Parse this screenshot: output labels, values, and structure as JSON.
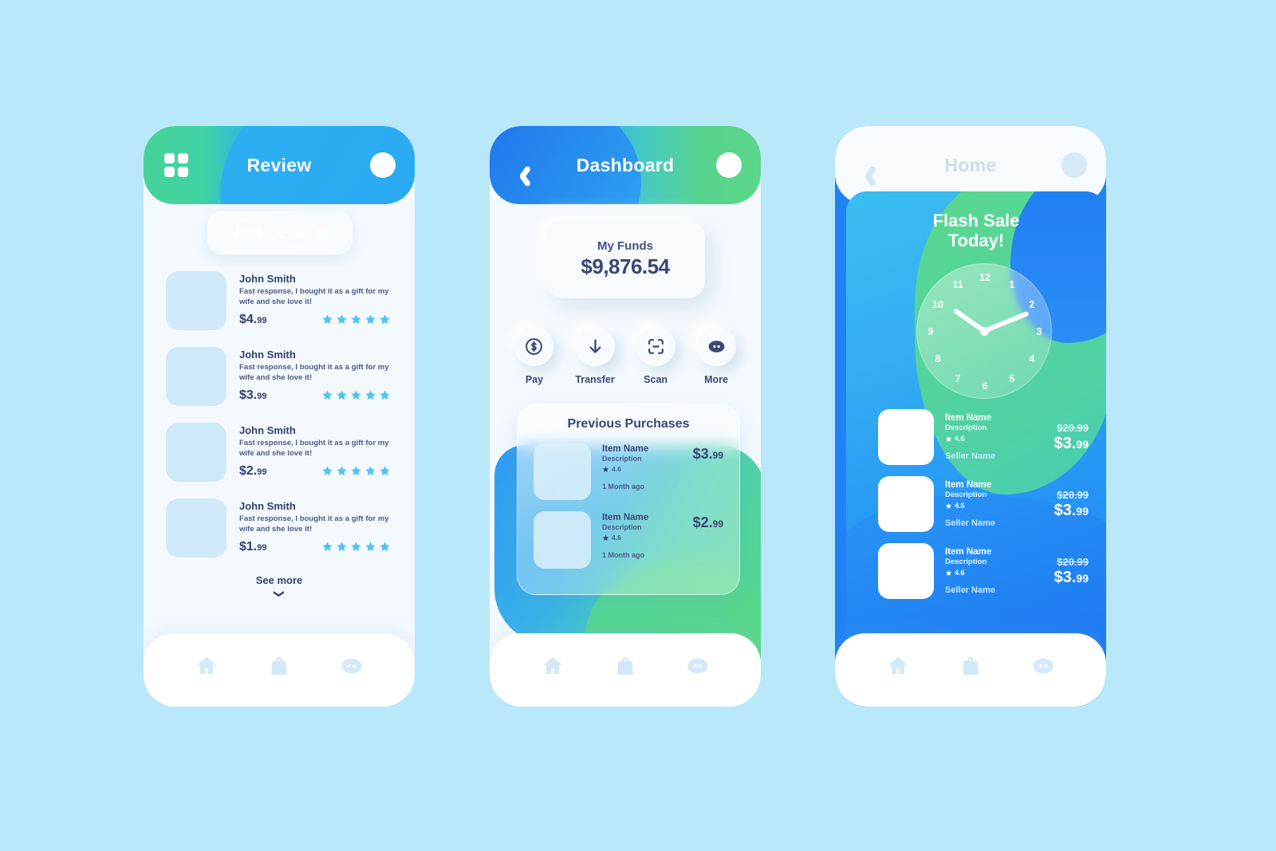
{
  "background_color": "#b9e8fa",
  "screens": {
    "review": {
      "header": {
        "title": "Review",
        "grid_icon": "grid-icon",
        "avatar": "avatar"
      },
      "rating_stars": 5,
      "list": [
        {
          "name": "John Smith",
          "text": "Fast response, I bought it as a gift for my wife and she love it!",
          "price_main": "$4.",
          "price_cents": "99",
          "stars": 5
        },
        {
          "name": "John Smith",
          "text": "Fast response, I bought it as a gift for my wife and she love it!",
          "price_main": "$3.",
          "price_cents": "99",
          "stars": 5
        },
        {
          "name": "John Smith",
          "text": "Fast response, I bought it as a gift for my wife and she love it!",
          "price_main": "$2.",
          "price_cents": "99",
          "stars": 5
        },
        {
          "name": "John Smith",
          "text": "Fast response, I bought it as a gift for my wife and she love it!",
          "price_main": "$1.",
          "price_cents": "99",
          "stars": 5
        }
      ],
      "see_more": "See more",
      "see_more_chevron": "chevron-down-icon"
    },
    "dashboard": {
      "header": {
        "title": "Dashboard",
        "back_icon": "chevron-left-icon",
        "avatar": "avatar"
      },
      "funds": {
        "label": "My Funds",
        "value": "$9,876.54"
      },
      "actions": [
        {
          "label": "Pay",
          "icon": "dollar-circle-icon"
        },
        {
          "label": "Transfer",
          "icon": "arrow-down-icon"
        },
        {
          "label": "Scan",
          "icon": "scan-icon"
        },
        {
          "label": "More",
          "icon": "dots-icon"
        }
      ],
      "purchases": {
        "title": "Previous Purchases",
        "items": [
          {
            "name": "Item Name",
            "description": "Description",
            "rating": "4.6",
            "time": "1 Month ago",
            "price_main": "$3.",
            "price_cents": "99"
          },
          {
            "name": "Item Name",
            "description": "Description",
            "rating": "4.6",
            "time": "1 Month ago",
            "price_main": "$2.",
            "price_cents": "99"
          }
        ]
      }
    },
    "home": {
      "header": {
        "title": "Home",
        "back_icon": "chevron-left-icon",
        "avatar": "avatar"
      },
      "hero": {
        "title_line1": "Flash Sale",
        "title_line2": "Today!",
        "clock_numbers": [
          "12",
          "1",
          "2",
          "3",
          "4",
          "5",
          "6",
          "7",
          "8",
          "9",
          "10",
          "11"
        ]
      },
      "products": [
        {
          "name": "Item Name",
          "description": "Description",
          "rating": "4.6",
          "seller": "Seller Name",
          "old_price": "$20.99",
          "price_main": "$3.",
          "price_cents": "99"
        },
        {
          "name": "Item Name",
          "description": "Description",
          "rating": "4.6",
          "seller": "Seller Name",
          "old_price": "$20.99",
          "price_main": "$3.",
          "price_cents": "99"
        },
        {
          "name": "Item Name",
          "description": "Description",
          "rating": "4.6",
          "seller": "Seller Name",
          "old_price": "$20.99",
          "price_main": "$3.",
          "price_cents": "99"
        }
      ]
    }
  },
  "bottom_nav": [
    {
      "icon": "home-icon"
    },
    {
      "icon": "bag-icon"
    },
    {
      "icon": "dots-icon"
    }
  ],
  "colors": {
    "accent_blue": "#2aa7f6",
    "accent_green": "#5bd78a",
    "text_dark": "#3b4677",
    "star_blue": "#4fc3f7"
  }
}
